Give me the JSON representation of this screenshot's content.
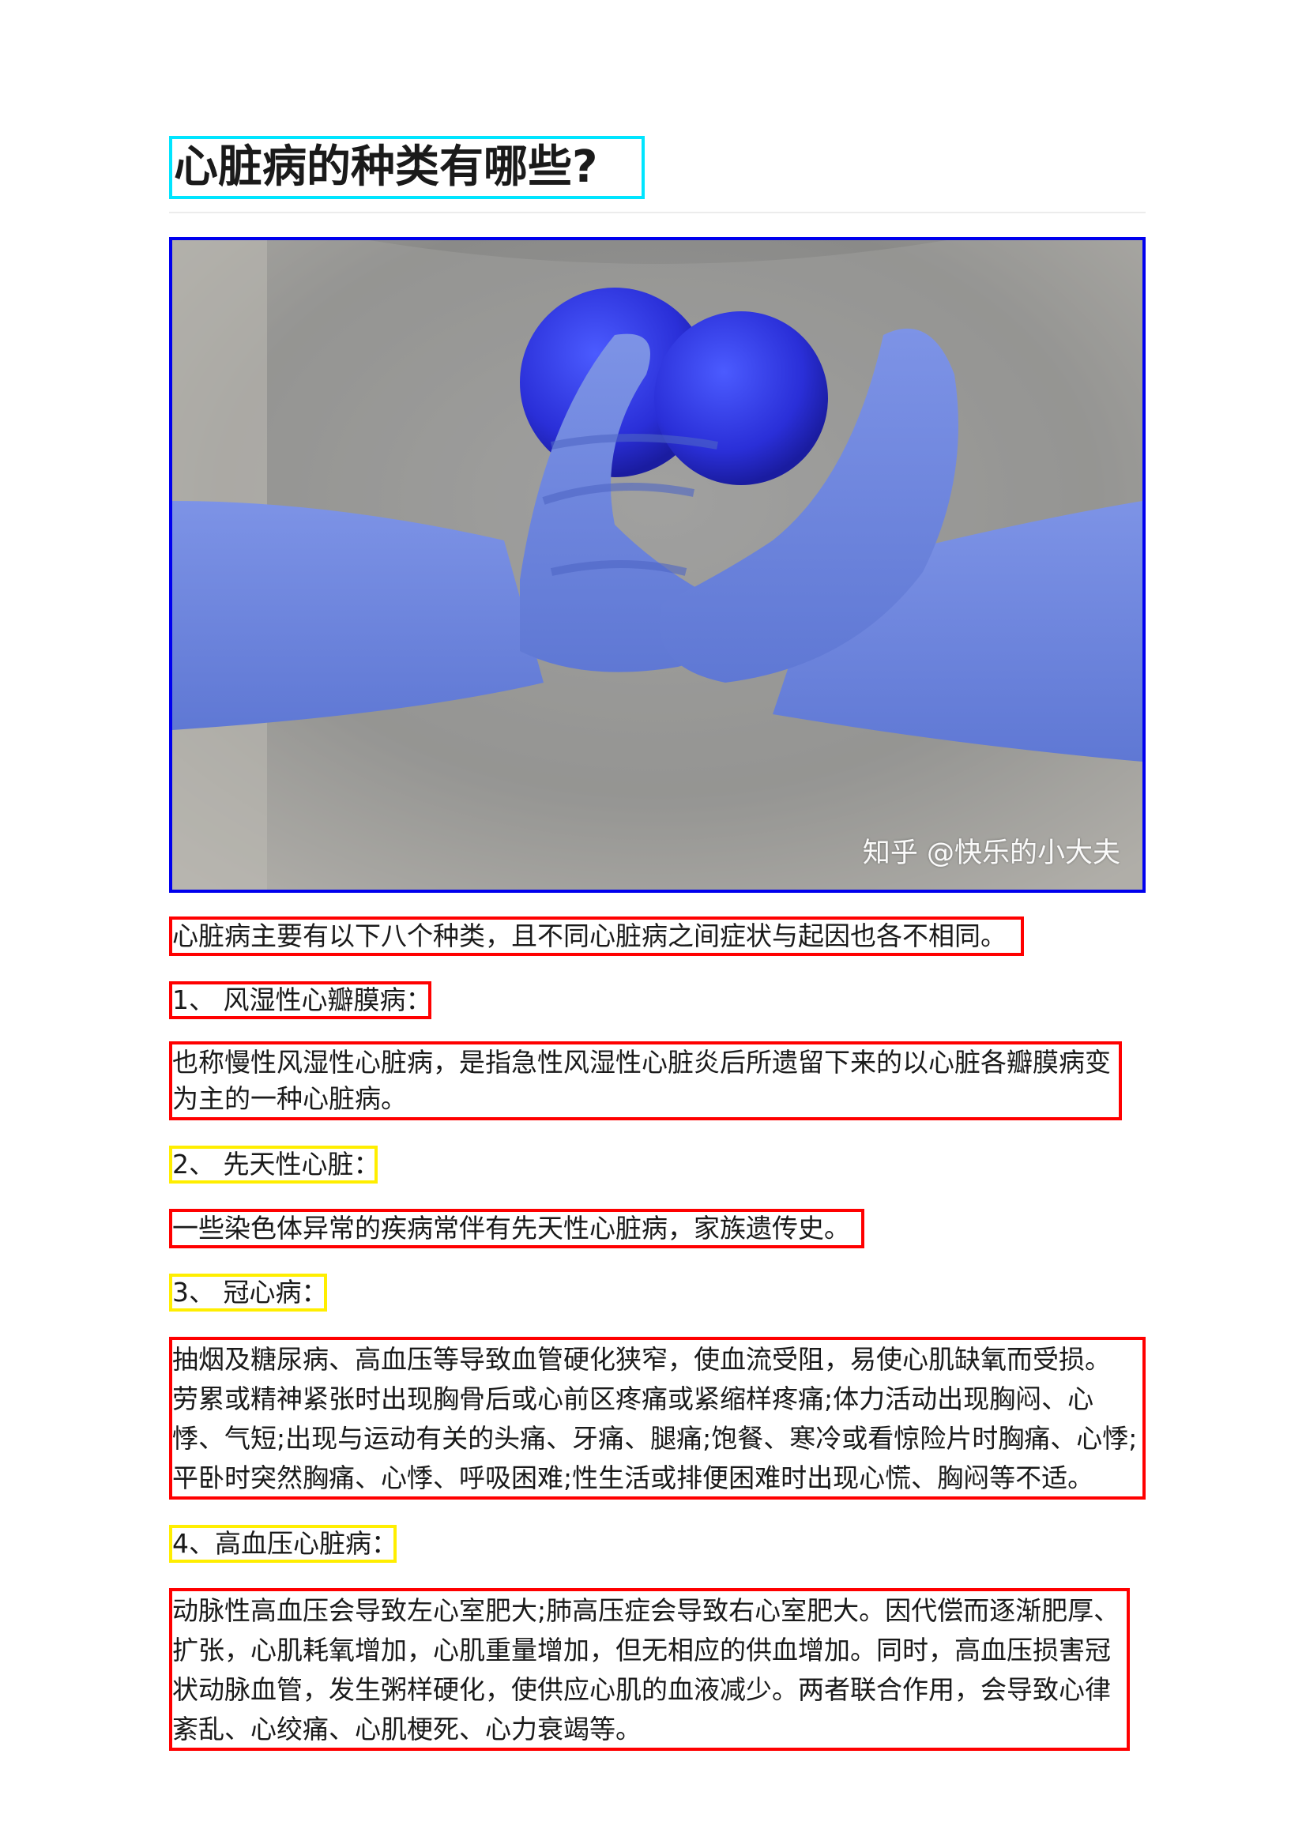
{
  "title": "心脏病的种类有哪些?",
  "figure": {
    "watermark": "知乎 @快乐的小大夫"
  },
  "intro": "心脏病主要有以下八个种类，且不同心脏病之间症状与起因也各不相同。",
  "sections": [
    {
      "heading": "1、 风湿性心瓣膜病：",
      "lines": [
        "也称慢性风湿性心脏病，是指急性风湿性心脏炎后所遗留下来的以心脏各瓣膜病变",
        "为主的一种心脏病。"
      ]
    },
    {
      "heading": "2、 先天性心脏：",
      "lines": [
        "一些染色体异常的疾病常伴有先天性心脏病，家族遗传史。"
      ]
    },
    {
      "heading": "3、 冠心病：",
      "lines": [
        "抽烟及糖尿病、高血压等导致血管硬化狭窄，使血流受阻，易使心肌缺氧而受损。",
        "劳累或精神紧张时出现胸骨后或心前区疼痛或紧缩样疼痛;体力活动出现胸闷、心",
        "悸、气短;出现与运动有关的头痛、牙痛、腿痛;饱餐、寒冷或看惊险片时胸痛、心悸;",
        "平卧时突然胸痛、心悸、呼吸困难;性生活或排便困难时出现心慌、胸闷等不适。"
      ]
    },
    {
      "heading": "4、高血压心脏病：",
      "lines": [
        "动脉性高血压会导致左心室肥大;肺高压症会导致右心室肥大。因代偿而逐渐肥厚、",
        "扩张，心肌耗氧增加，心肌重量增加，但无相应的供血增加。同时，高血压损害冠",
        "状动脉血管，发生粥样硬化，使供应心肌的血液减少。两者联合作用，会导致心律",
        "紊乱、心绞痛、心肌梗死、心力衰竭等。"
      ]
    }
  ],
  "colors": {
    "title_box": "#00e5ff",
    "figure_box": "#0000ee",
    "heading_box": "#ffee00",
    "text_box": "#ff0000"
  }
}
